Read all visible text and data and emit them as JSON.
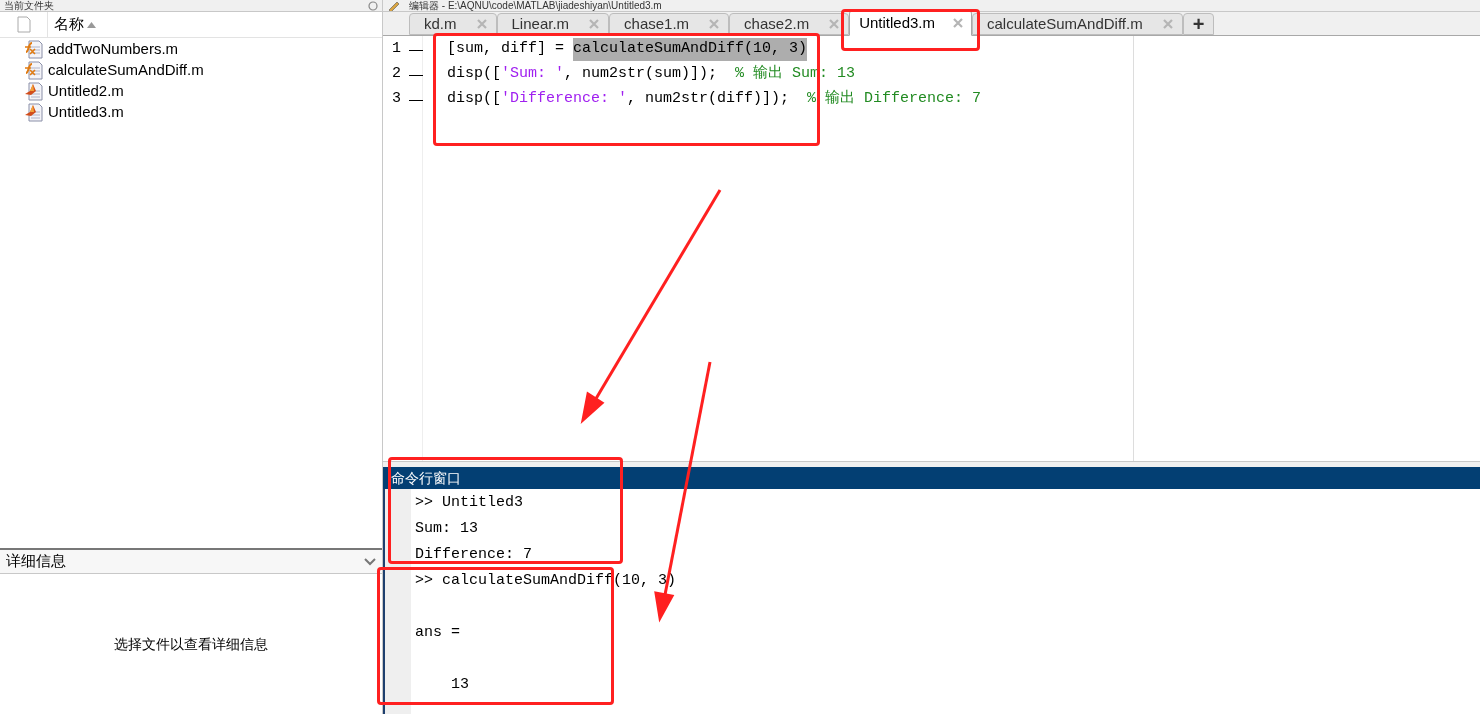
{
  "current_folder": {
    "title": "当前文件夹",
    "column_header": "名称",
    "files": [
      {
        "name": "addTwoNumbers.m",
        "kind": "function",
        "selected": false
      },
      {
        "name": "calculateSumAndDiff.m",
        "kind": "function",
        "selected": false
      },
      {
        "name": "Untitled2.m",
        "kind": "script",
        "selected": false
      },
      {
        "name": "Untitled3.m",
        "kind": "script",
        "selected": false
      }
    ]
  },
  "details": {
    "title": "详细信息",
    "expanded": true,
    "message": "选择文件以查看详细信息"
  },
  "editor": {
    "title": "编辑器 - E:\\AQNU\\code\\MATLAB\\jiadeshiyan\\Untitled3.m",
    "tabs": [
      {
        "label": "kd.m",
        "selected": false
      },
      {
        "label": "Linear.m",
        "selected": false
      },
      {
        "label": "chase1.m",
        "selected": false
      },
      {
        "label": "chase2.m",
        "selected": false
      },
      {
        "label": "Untitled3.m",
        "selected": true
      },
      {
        "label": "calculateSumAndDiff.m",
        "selected": false
      }
    ],
    "new_tab": "+",
    "lines": [
      {
        "number": "1",
        "marker": "—",
        "segments": [
          {
            "kind": "code",
            "text": "[sum, diff] = "
          },
          {
            "kind": "selection",
            "text": "calculateSumAndDiff(10, 3)"
          }
        ]
      },
      {
        "number": "2",
        "marker": "—",
        "segments": [
          {
            "kind": "code",
            "text": "disp(["
          },
          {
            "kind": "string",
            "text": "'Sum: '"
          },
          {
            "kind": "code",
            "text": ", num2str(sum)]);  "
          },
          {
            "kind": "comment",
            "text": "% 输出 Sum: 13"
          }
        ]
      },
      {
        "number": "3",
        "marker": "—",
        "segments": [
          {
            "kind": "code",
            "text": "disp(["
          },
          {
            "kind": "string",
            "text": "'Difference: '"
          },
          {
            "kind": "code",
            "text": ", num2str(diff)]);  "
          },
          {
            "kind": "comment",
            "text": "% 输出 Difference: 7"
          }
        ]
      }
    ]
  },
  "command_window": {
    "title": "命令行窗口",
    "blocks": [
      [
        ">> Untitled3",
        "Sum: 13",
        "Difference: 7",
        ">> calculateSumAndDiff(10, 3)"
      ],
      [
        "ans ="
      ],
      [
        "    13"
      ]
    ]
  }
}
